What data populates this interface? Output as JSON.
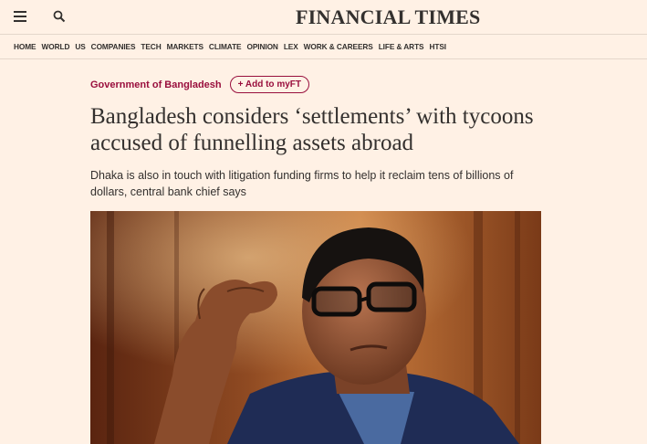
{
  "header": {
    "brand": "FINANCIAL TIMES",
    "menu_icon": "hamburger-menu-icon",
    "search_icon": "search-icon"
  },
  "nav": {
    "items": [
      "HOME",
      "WORLD",
      "US",
      "COMPANIES",
      "TECH",
      "MARKETS",
      "CLIMATE",
      "OPINION",
      "LEX",
      "WORK & CAREERS",
      "LIFE & ARTS",
      "HTSI"
    ]
  },
  "article": {
    "topic": "Government of Bangladesh",
    "add_to_myft": "+ Add to myFT",
    "headline": "Bangladesh considers ‘settlements’ with tycoons accused of funnelling assets abroad",
    "standfirst": "Dhaka is also in touch with litigation funding firms to help it reclaim tens of billions of dollars, central bank chief says"
  },
  "colors": {
    "background": "#fff1e5",
    "accent": "#990f3d",
    "text": "#33302e"
  }
}
